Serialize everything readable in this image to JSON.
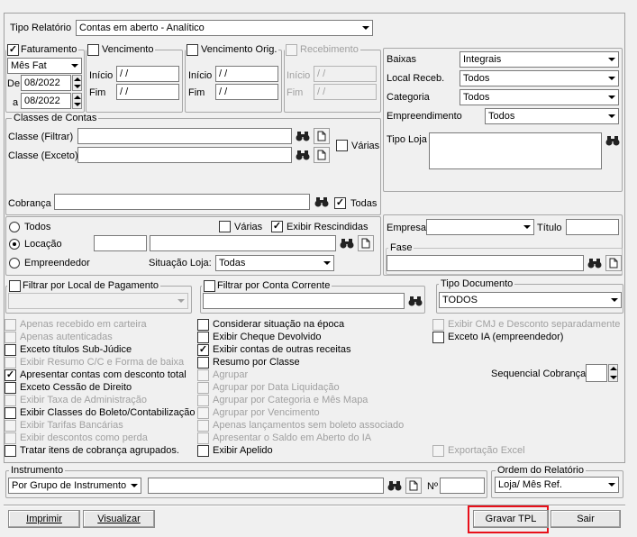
{
  "top": {
    "tipo_relatorio_label": "Tipo Relatório",
    "tipo_relatorio_value": "Contas em aberto - Analítico"
  },
  "faturamento": {
    "label": "Faturamento",
    "mode": "Mês Fat",
    "de": "De",
    "a": "a",
    "date_from": "08/2022",
    "date_to": "08/2022"
  },
  "vencimento": {
    "label": "Vencimento",
    "inicio": "Início",
    "fim": "Fim",
    "inicio_value": " /  /",
    "fim_value": " /  /"
  },
  "vencimento_orig": {
    "label": "Vencimento Orig.",
    "inicio": "Início",
    "fim": "Fim",
    "inicio_value": " /  /",
    "fim_value": " /  /"
  },
  "recebimento": {
    "label": "Recebimento",
    "inicio": "Início",
    "fim": "Fim",
    "inicio_value": " /  /",
    "fim_value": " /  /"
  },
  "right": {
    "baixas_label": "Baixas",
    "baixas_value": "Integrais",
    "local_label": "Local Receb.",
    "local_value": "Todos",
    "categoria_label": "Categoria",
    "categoria_value": "Todos",
    "empreendimento_label": "Empreendimento",
    "empreendimento_value": "Todos",
    "tipo_loja_label": "Tipo Loja"
  },
  "classes": {
    "group_label": "Classes de Contas",
    "filtrar_label": "Classe (Filtrar)",
    "exceto_label": "Classe (Exceto)",
    "varias_label": "Várias",
    "cobranca_label": "Cobrança",
    "todas_label": "Todas"
  },
  "opts": {
    "todos_label": "Todos",
    "locacao_label": "Locação",
    "empreendedor_label": "Empreendedor",
    "varias_label": "Várias",
    "exibir_rescindidas_label": "Exibir Rescindidas",
    "situacao_label": "Situação Loja:",
    "situacao_value": "Todas"
  },
  "empresa": {
    "label": "Empresa",
    "titulo_label": "Título",
    "fase_label": "Fase"
  },
  "filtros": {
    "local_pag_label": "Filtrar por Local de Pagamento",
    "conta_corrente_label": "Filtrar por Conta Corrente",
    "tipo_doc_label": "Tipo Documento",
    "tipo_doc_value": "TODOS"
  },
  "col1": [
    {
      "text": "Apenas recebido em carteira",
      "enabled": false,
      "checked": false
    },
    {
      "text": "Apenas autenticadas",
      "enabled": false,
      "checked": false
    },
    {
      "text": "Exceto títulos Sub-Júdice",
      "enabled": true,
      "checked": false
    },
    {
      "text": "Exibir Resumo C/C e Forma de baixa",
      "enabled": false,
      "checked": false
    },
    {
      "text": "Apresentar contas com desconto total",
      "enabled": true,
      "checked": true
    },
    {
      "text": "Exceto Cessão de Direito",
      "enabled": true,
      "checked": false
    },
    {
      "text": "Exibir Taxa de Administração",
      "enabled": false,
      "checked": false
    },
    {
      "text": "Exibir Classes do Boleto/Contabilização",
      "enabled": true,
      "checked": false
    },
    {
      "text": "Exibir Tarifas Bancárias",
      "enabled": false,
      "checked": false
    },
    {
      "text": "Exibir descontos como perda",
      "enabled": false,
      "checked": false
    },
    {
      "text": "Tratar itens de cobrança agrupados.",
      "enabled": true,
      "checked": false
    }
  ],
  "col2": [
    {
      "text": "Considerar situação na época",
      "enabled": true,
      "checked": false
    },
    {
      "text": "Exibir Cheque Devolvido",
      "enabled": true,
      "checked": false
    },
    {
      "text": "Exibir contas de outras receitas",
      "enabled": true,
      "checked": true
    },
    {
      "text": "Resumo por Classe",
      "enabled": true,
      "checked": false
    },
    {
      "text": "Agrupar",
      "enabled": false,
      "checked": false
    },
    {
      "text": "Agrupar por Data Liquidação",
      "enabled": false,
      "checked": false
    },
    {
      "text": "Agrupar por Categoria e Mês Mapa",
      "enabled": false,
      "checked": false
    },
    {
      "text": "Agrupar por Vencimento",
      "enabled": false,
      "checked": false
    },
    {
      "text": "Apenas lançamentos sem boleto associado",
      "enabled": false,
      "checked": false
    },
    {
      "text": "Apresentar o Saldo em Aberto do IA",
      "enabled": false,
      "checked": false
    },
    {
      "text": "Exibir Apelido",
      "enabled": true,
      "checked": false
    }
  ],
  "col3": {
    "exibir_cmj": "Exibir CMJ e Desconto separadamente",
    "exceto_ia": "Exceto IA (empreendedor)",
    "seq_cobranca": "Sequencial Cobrança",
    "exportacao_excel": "Exportação Excel"
  },
  "instrumento": {
    "label": "Instrumento",
    "value": "Por Grupo de Instrumento",
    "no_label": "Nº",
    "ordem_label": "Ordem do Relatório",
    "ordem_value": "Loja/ Mês Ref."
  },
  "buttons": {
    "imprimir": "Imprimir",
    "visualizar": "Visualizar",
    "gravar_tpl": "Gravar TPL",
    "sair": "Sair"
  },
  "check_mark": "✓"
}
